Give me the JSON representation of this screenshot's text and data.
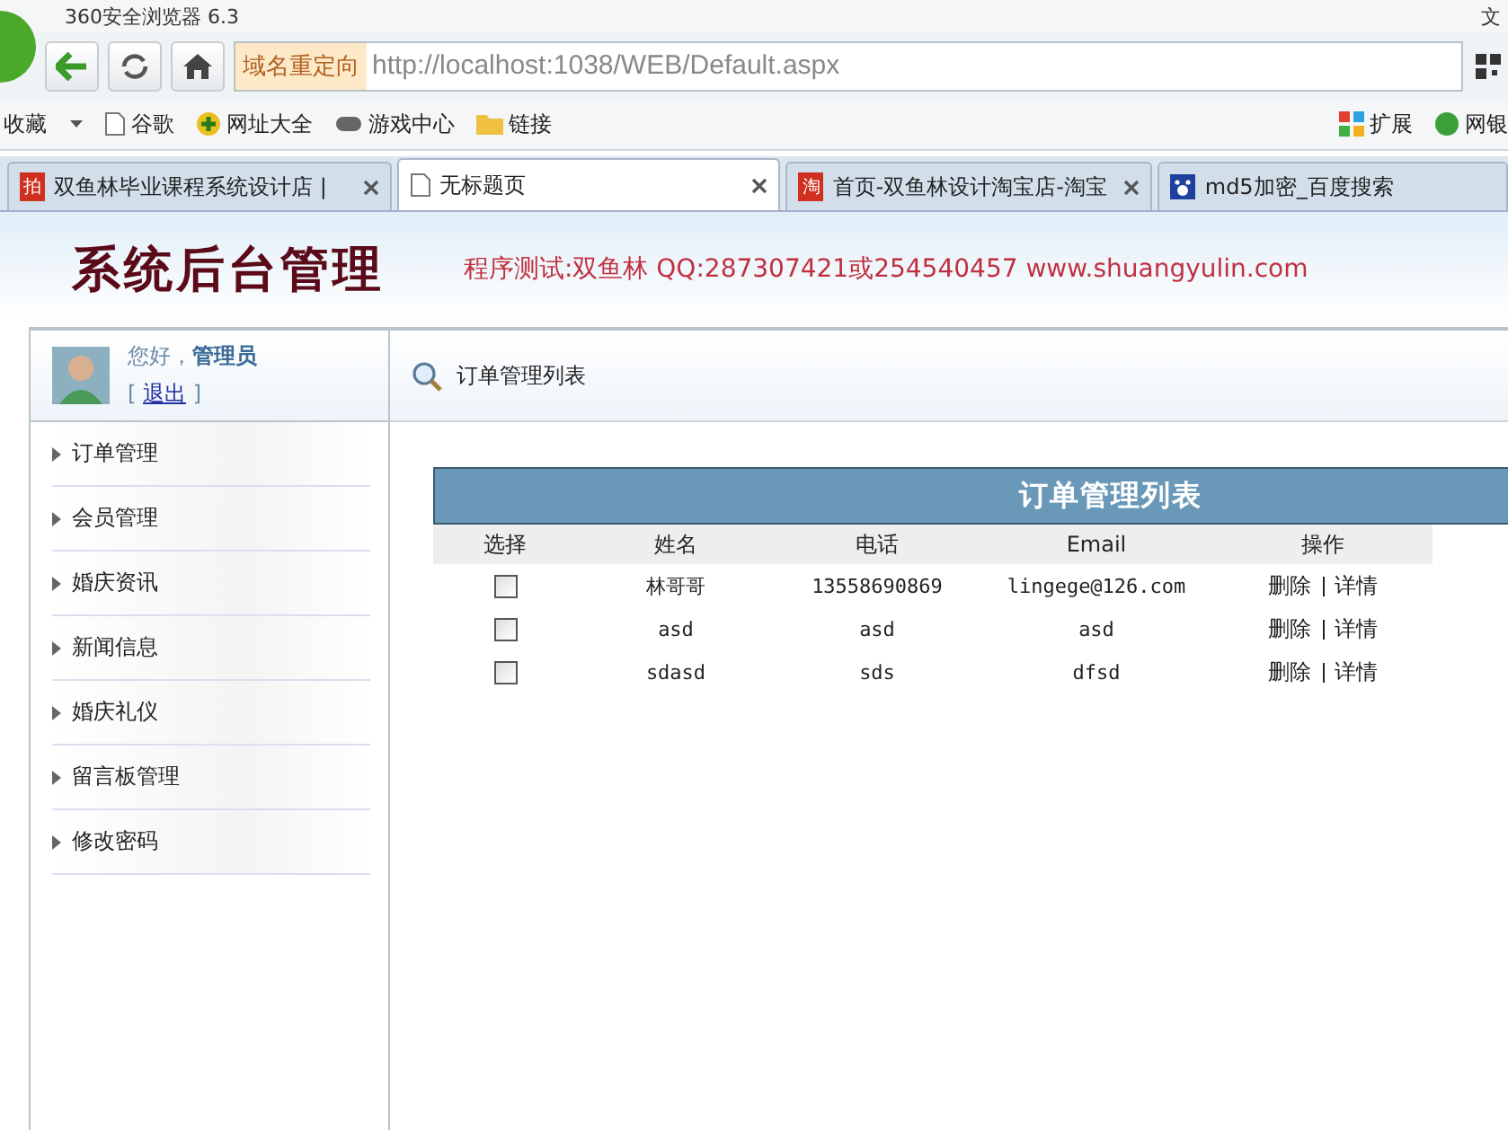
{
  "browser": {
    "title": "360安全浏览器 6.3",
    "title_right": "文",
    "redirect_label": "域名重定向",
    "url": "http://localhost:1038/WEB/Default.aspx",
    "bookmarks_left": [
      {
        "label": "收藏",
        "kind": "menu"
      },
      {
        "label": "谷歌",
        "kind": "page"
      },
      {
        "label": "网址大全",
        "kind": "plus"
      },
      {
        "label": "游戏中心",
        "kind": "game"
      },
      {
        "label": "链接",
        "kind": "folder"
      }
    ],
    "bookmarks_right": [
      {
        "label": "扩展",
        "kind": "grid"
      },
      {
        "label": "网银",
        "kind": "shield"
      }
    ],
    "tabs": [
      {
        "label": "双鱼林毕业课程系统设计店 |",
        "kind": "text",
        "icon": "拍",
        "selected": false
      },
      {
        "label": "无标题页",
        "kind": "page",
        "selected": true
      },
      {
        "label": "首页-双鱼林设计淘宝店-淘宝",
        "kind": "text",
        "icon": "淘",
        "selected": false
      },
      {
        "label": "md5加密_百度搜索",
        "kind": "paw",
        "selected": false
      }
    ]
  },
  "header": {
    "logo": "系统后台管理",
    "tagline": "程序测试:双鱼林 QQ:287307421或254540457 www.shuangyulin.com"
  },
  "user": {
    "greeting": "您好，",
    "name": "管理员",
    "bracket_open": "[",
    "logout": "退出",
    "bracket_close": "]"
  },
  "breadcrumb": "订单管理列表",
  "menu": [
    "订单管理",
    "会员管理",
    "婚庆资讯",
    "新闻信息",
    "婚庆礼仪",
    "留言板管理",
    "修改密码"
  ],
  "table": {
    "title": "订单管理列表",
    "columns": [
      "选择",
      "姓名",
      "电话",
      "Email",
      "操作"
    ],
    "rows": [
      {
        "checked": false,
        "name": "林哥哥",
        "phone": "13558690869",
        "email": "lingege@126.com",
        "actions": [
          "删除",
          "详情"
        ]
      },
      {
        "checked": false,
        "name": "asd",
        "phone": "asd",
        "email": "asd",
        "actions": [
          "删除",
          "详情"
        ]
      },
      {
        "checked": false,
        "name": "sdasd",
        "phone": "sds",
        "email": "dfsd",
        "actions": [
          "删除",
          "详情"
        ]
      }
    ]
  }
}
